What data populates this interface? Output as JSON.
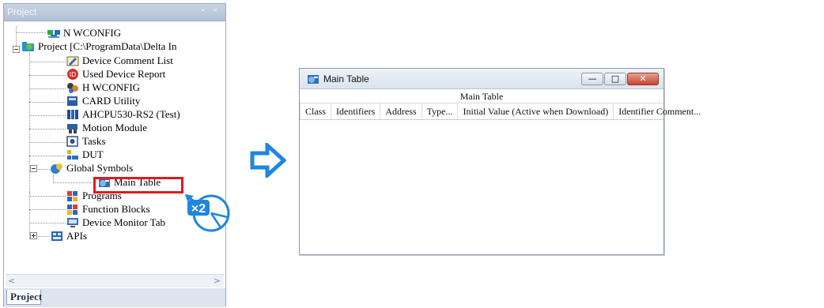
{
  "project_panel": {
    "title": "Project",
    "controls": "▪ ×",
    "tab_label": "Project",
    "tree": {
      "nwconfig": "N WCONFIG",
      "project_root": "Project [C:\\ProgramData\\Delta In",
      "device_comment_list": "Device Comment List",
      "used_device_report": "Used Device Report",
      "hwconfig": "H WCONFIG",
      "card_utility": "CARD Utility",
      "cpu": "AHCPU530-RS2  (Test)",
      "motion_module": "Motion Module",
      "tasks": "Tasks",
      "dut": "DUT",
      "global_symbols": "Global Symbols",
      "main_table": "Main Table",
      "programs": "Programs",
      "function_blocks": "Function Blocks",
      "device_monitor_table": "Device Monitor Tab",
      "apis": "APIs"
    },
    "scroll_left": "<",
    "scroll_right": ">"
  },
  "annotation": {
    "double_click_badge": "×2",
    "highlight_color": "#e5181f",
    "arrow_color": "#1f86e0"
  },
  "main_table_window": {
    "title": "Main Table",
    "minimize_glyph": "—",
    "maximize_glyph": "□",
    "close_glyph": "✕",
    "caption": "Main Table",
    "columns": [
      "Class",
      "Identifiers",
      "Address",
      "Type...",
      "Initial Value (Active when Download)",
      "Identifier Comment..."
    ]
  }
}
